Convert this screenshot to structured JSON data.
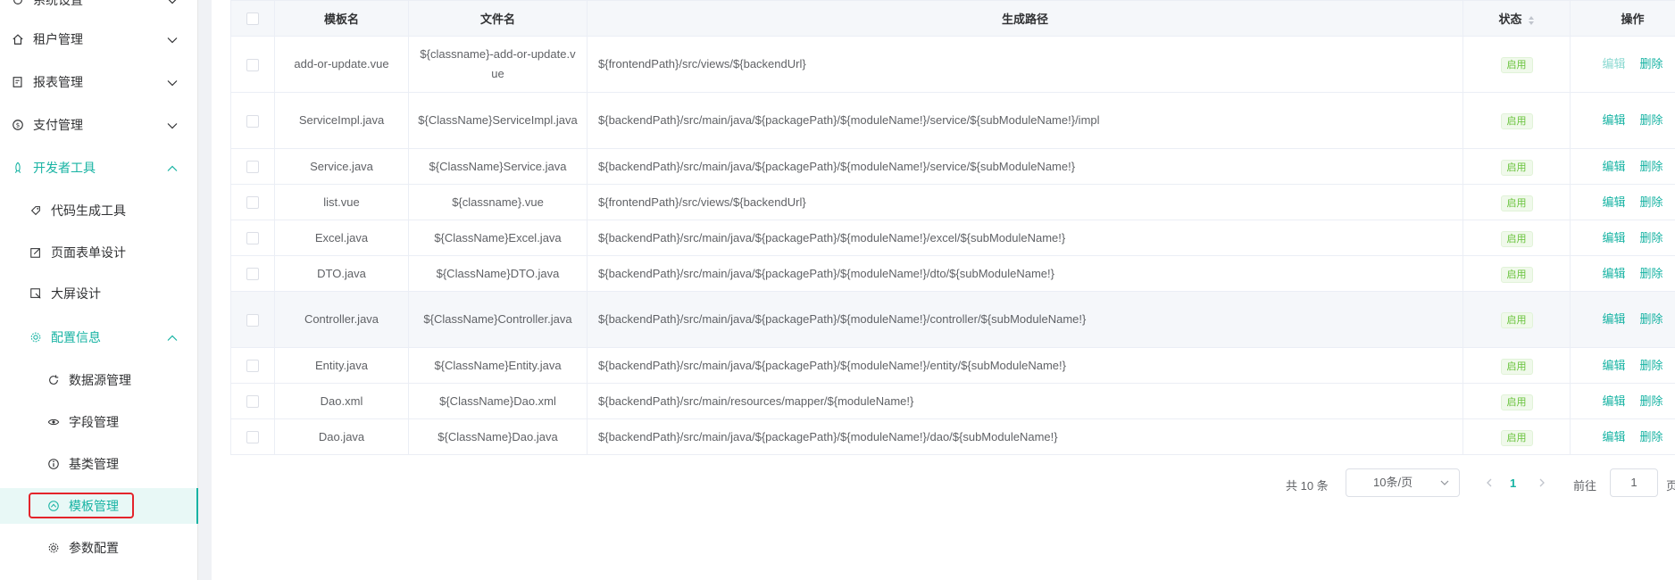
{
  "sidebar": {
    "items": [
      {
        "label": "系统设置",
        "icon": "settings-icon"
      },
      {
        "label": "租户管理",
        "icon": "home-icon"
      },
      {
        "label": "报表管理",
        "icon": "report-icon"
      },
      {
        "label": "支付管理",
        "icon": "payment-icon"
      },
      {
        "label": "开发者工具",
        "icon": "rocket-icon"
      },
      {
        "label": "代码生成工具",
        "icon": "tag-icon"
      },
      {
        "label": "页面表单设计",
        "icon": "edit-icon"
      },
      {
        "label": "大屏设计",
        "icon": "screen-icon"
      },
      {
        "label": "配置信息",
        "icon": "gear-icon"
      },
      {
        "label": "数据源管理",
        "icon": "refresh-icon"
      },
      {
        "label": "字段管理",
        "icon": "eye-icon"
      },
      {
        "label": "基类管理",
        "icon": "info-icon"
      },
      {
        "label": "模板管理",
        "icon": "template-icon"
      },
      {
        "label": "参数配置",
        "icon": "settings-icon"
      }
    ]
  },
  "table": {
    "headers": {
      "name": "模板名",
      "file": "文件名",
      "path": "生成路径",
      "status": "状态",
      "ops": "操作"
    },
    "edit_label": "编辑",
    "delete_label": "删除",
    "rows": [
      {
        "name": "add-or-update.vue",
        "file": "${classname}-add-or-update.vue",
        "path": "${frontendPath}/src/views/${backendUrl}",
        "status": "启用"
      },
      {
        "name": "ServiceImpl.java",
        "file": "${ClassName}ServiceImpl.java",
        "path": "${backendPath}/src/main/java/${packagePath}/${moduleName!}/service/${subModuleName!}/impl",
        "status": "启用"
      },
      {
        "name": "Service.java",
        "file": "${ClassName}Service.java",
        "path": "${backendPath}/src/main/java/${packagePath}/${moduleName!}/service/${subModuleName!}",
        "status": "启用"
      },
      {
        "name": "list.vue",
        "file": "${classname}.vue",
        "path": "${frontendPath}/src/views/${backendUrl}",
        "status": "启用"
      },
      {
        "name": "Excel.java",
        "file": "${ClassName}Excel.java",
        "path": "${backendPath}/src/main/java/${packagePath}/${moduleName!}/excel/${subModuleName!}",
        "status": "启用"
      },
      {
        "name": "DTO.java",
        "file": "${ClassName}DTO.java",
        "path": "${backendPath}/src/main/java/${packagePath}/${moduleName!}/dto/${subModuleName!}",
        "status": "启用"
      },
      {
        "name": "Controller.java",
        "file": "${ClassName}Controller.java",
        "path": "${backendPath}/src/main/java/${packagePath}/${moduleName!}/controller/${subModuleName!}",
        "status": "启用"
      },
      {
        "name": "Entity.java",
        "file": "${ClassName}Entity.java",
        "path": "${backendPath}/src/main/java/${packagePath}/${moduleName!}/entity/${subModuleName!}",
        "status": "启用"
      },
      {
        "name": "Dao.xml",
        "file": "${ClassName}Dao.xml",
        "path": "${backendPath}/src/main/resources/mapper/${moduleName!}",
        "status": "启用"
      },
      {
        "name": "Dao.java",
        "file": "${ClassName}Dao.java",
        "path": "${backendPath}/src/main/java/${packagePath}/${moduleName!}/dao/${subModuleName!}",
        "status": "启用"
      }
    ]
  },
  "pagination": {
    "total": "共 10 条",
    "page_size": "10条/页",
    "current_page": "1",
    "goto_label": "前往",
    "goto_value": "1",
    "page_suffix": "页"
  },
  "colors": {
    "accent": "#17b3a3",
    "status_green": "#67c23a",
    "highlight": "#e4242b"
  }
}
